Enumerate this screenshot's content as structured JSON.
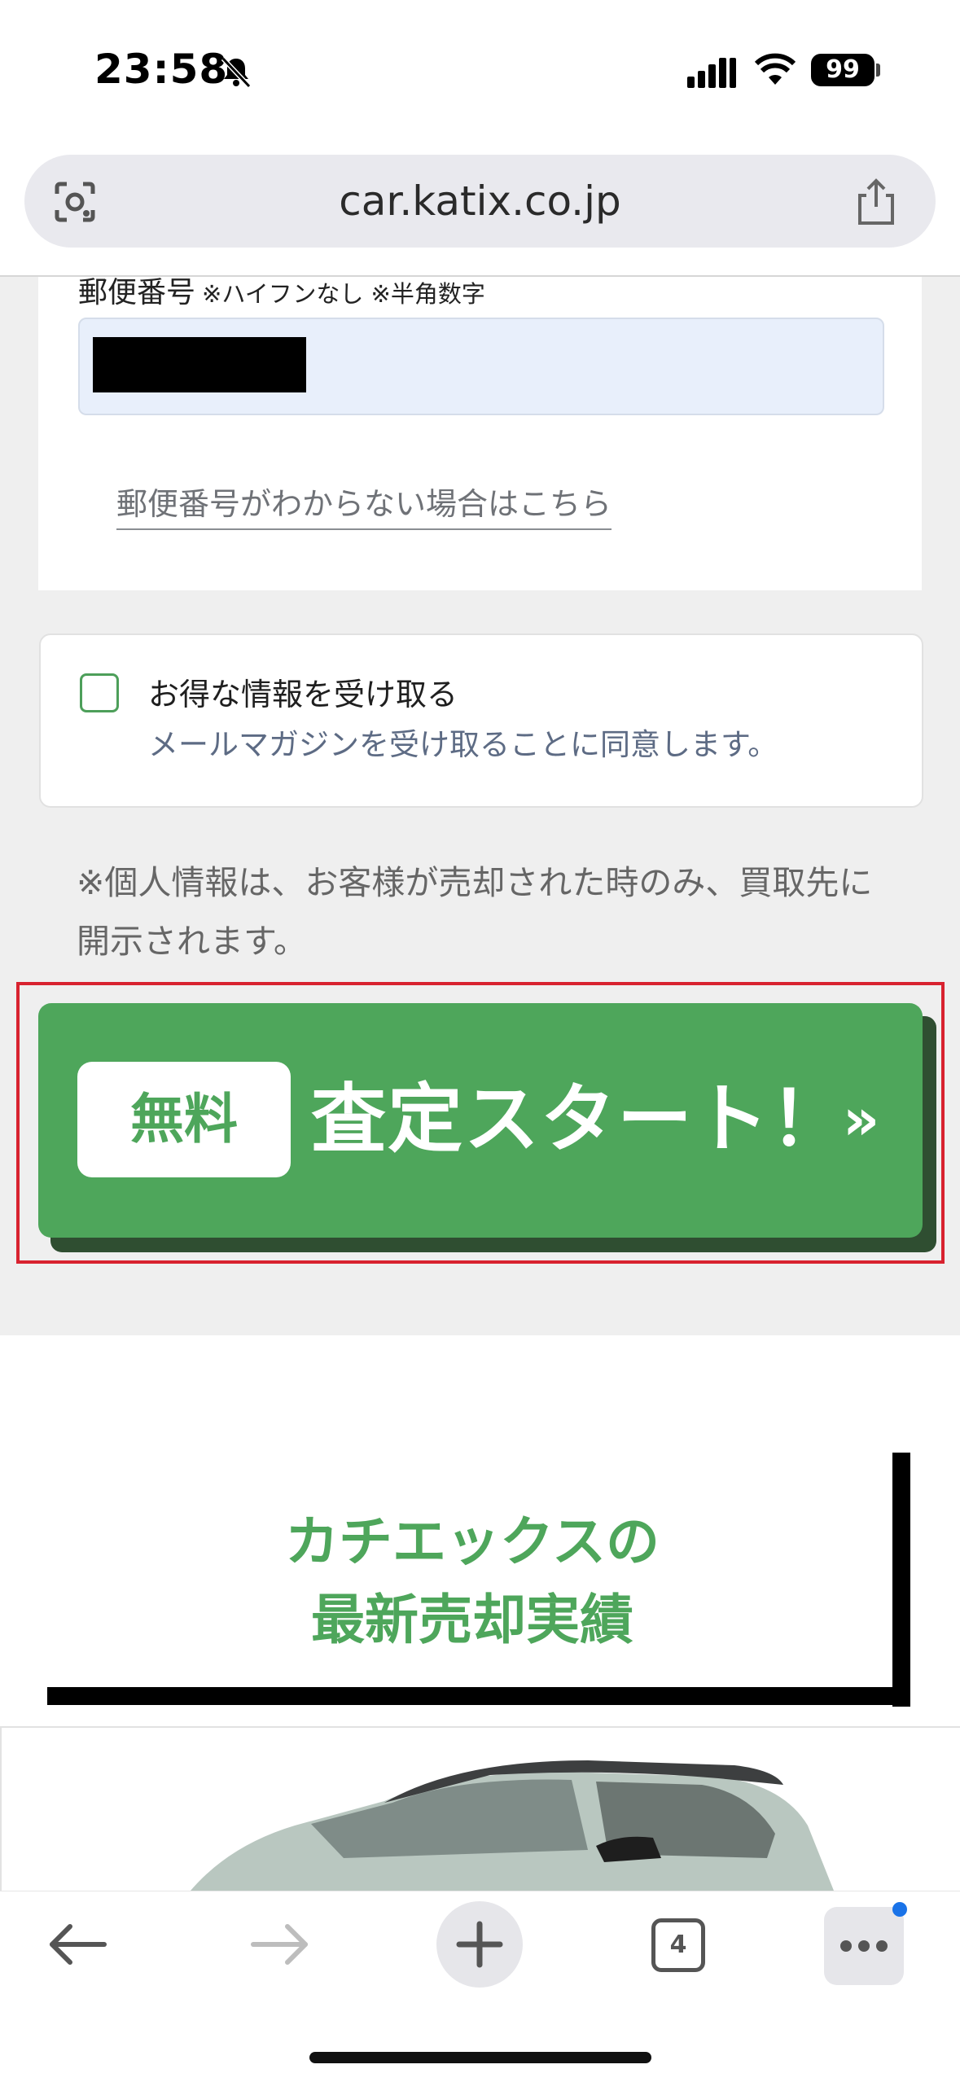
{
  "status_bar": {
    "time": "23:58",
    "battery": "99"
  },
  "browser": {
    "url": "car.katix.co.jp",
    "tab_count": "4"
  },
  "form": {
    "postal_label": "郵便番号",
    "postal_note": "※ハイフンなし ※半角数字",
    "postal_link": "郵便番号がわからない場合はこちら"
  },
  "newsletter": {
    "title": "お得な情報を受け取る",
    "subtitle": "メールマガジンを受け取ることに同意します。",
    "checked": false
  },
  "privacy_note": "※個人情報は、お客様が売却された時のみ、買取先に開示されます。",
  "cta": {
    "badge": "無料",
    "label": "査定スタート！",
    "arrow": "»"
  },
  "results": {
    "line1": "カチエックスの",
    "line2": "最新売却実績"
  },
  "colors": {
    "accent_green": "#4ea65b",
    "cta_highlight": "#d8222f",
    "link_gray": "#6f7277"
  }
}
